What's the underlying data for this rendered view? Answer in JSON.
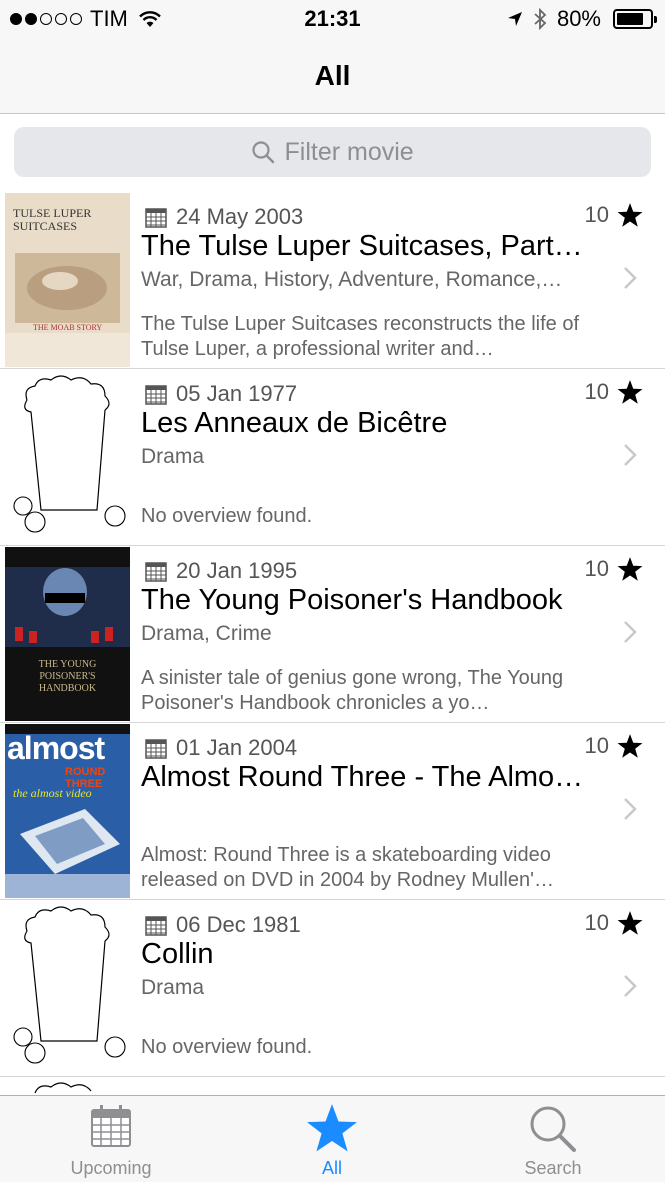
{
  "status_bar": {
    "carrier": "TIM",
    "time": "21:31",
    "battery": "80%",
    "battery_level": 0.8
  },
  "nav": {
    "title": "All"
  },
  "search": {
    "placeholder": "Filter movie"
  },
  "movies": [
    {
      "date": "24 May 2003",
      "rating": "10",
      "title": "The Tulse Luper Suitcases, Part…",
      "genres": "War, Drama, History, Adventure, Romance,…",
      "overview": "The Tulse Luper Suitcases reconstructs the life of Tulse Luper, a professional writer and…",
      "poster": {
        "kind": "image",
        "title": "TULSE LUPER SUITCASES",
        "subtitle": "THE MOAB STORY"
      }
    },
    {
      "date": "05 Jan 1977",
      "rating": "10",
      "title": "Les Anneaux de Bicêtre",
      "genres": "Drama",
      "overview": "No overview found.",
      "poster": {
        "kind": "placeholder"
      }
    },
    {
      "date": "20 Jan 1995",
      "rating": "10",
      "title": "The Young Poisoner's Handbook",
      "genres": "Drama, Crime",
      "overview": "A sinister tale of genius gone wrong, The Young Poisoner's Handbook chronicles a yo…",
      "poster": {
        "kind": "image",
        "title": "THE YOUNG POISONER'S HANDBOOK"
      }
    },
    {
      "date": "01 Jan 2004",
      "rating": "10",
      "title": "Almost Round Three - The Almo…",
      "genres": "",
      "overview": "Almost: Round Three is a skateboarding video released on DVD in 2004 by Rodney Mullen'…",
      "poster": {
        "kind": "image",
        "title": "almost",
        "subtitle": "ROUND THREE",
        "tagline": "the almost video"
      }
    },
    {
      "date": "06 Dec 1981",
      "rating": "10",
      "title": "Collin",
      "genres": "Drama",
      "overview": "No overview found.",
      "poster": {
        "kind": "placeholder"
      }
    }
  ],
  "tabs": [
    {
      "label": "Upcoming",
      "icon": "calendar-icon",
      "active": false
    },
    {
      "label": "All",
      "icon": "star-icon",
      "active": true
    },
    {
      "label": "Search",
      "icon": "search-icon",
      "active": false
    }
  ],
  "colors": {
    "accent": "#1a8cff",
    "inactive": "#8e8e93"
  }
}
